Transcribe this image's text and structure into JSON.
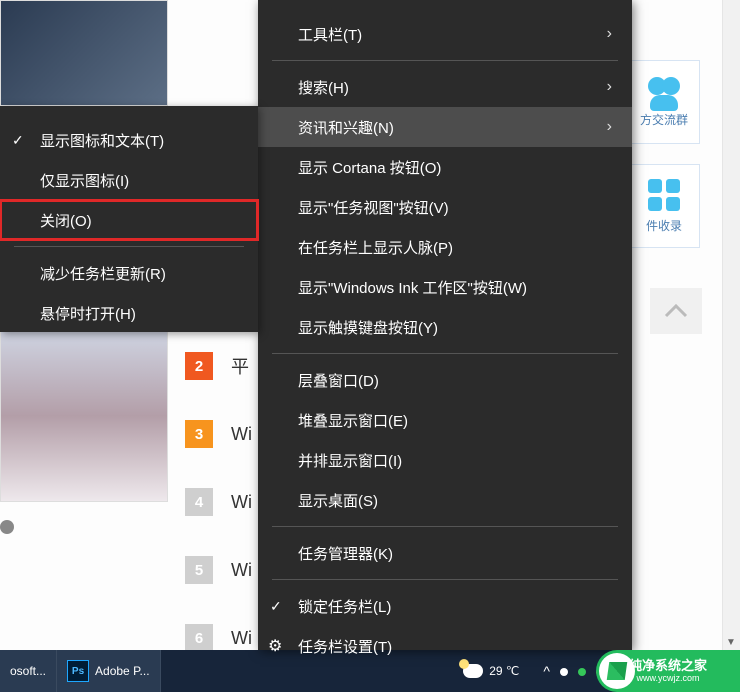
{
  "submenu": {
    "items": [
      {
        "label": "显示图标和文本(T)",
        "checked": true
      },
      {
        "label": "仅显示图标(I)",
        "checked": false
      },
      {
        "label": "关闭(O)",
        "checked": false,
        "highlighted": true
      }
    ],
    "group2": [
      {
        "label": "减少任务栏更新(R)"
      },
      {
        "label": "悬停时打开(H)"
      }
    ]
  },
  "contextmenu": {
    "g1": [
      {
        "label": "工具栏(T)",
        "arrow": true
      }
    ],
    "g2": [
      {
        "label": "搜索(H)",
        "arrow": true
      },
      {
        "label": "资讯和兴趣(N)",
        "arrow": true,
        "hover": true
      },
      {
        "label": "显示 Cortana 按钮(O)"
      },
      {
        "label": "显示\"任务视图\"按钮(V)"
      },
      {
        "label": "在任务栏上显示人脉(P)"
      },
      {
        "label": "显示\"Windows Ink 工作区\"按钮(W)"
      },
      {
        "label": "显示触摸键盘按钮(Y)"
      }
    ],
    "g3": [
      {
        "label": "层叠窗口(D)"
      },
      {
        "label": "堆叠显示窗口(E)"
      },
      {
        "label": "并排显示窗口(I)"
      },
      {
        "label": "显示桌面(S)"
      }
    ],
    "g4": [
      {
        "label": "任务管理器(K)"
      }
    ],
    "g5": [
      {
        "label": "锁定任务栏(L)",
        "checked": true
      },
      {
        "label": "任务栏设置(T)",
        "gear": true
      }
    ]
  },
  "bg_list": {
    "items": [
      {
        "n": "2",
        "text": "平",
        "cls": "n2"
      },
      {
        "n": "3",
        "text": "Wi",
        "cls": "n3"
      },
      {
        "n": "4",
        "text": "Wi",
        "cls": "n4"
      },
      {
        "n": "5",
        "text": "Wi",
        "cls": "n5"
      },
      {
        "n": "6",
        "text": "Wi",
        "cls": "n6"
      }
    ]
  },
  "side_cards": {
    "card1": "方交流群",
    "card2": "件收录"
  },
  "taskbar": {
    "app_edge_suffix": "osoft...",
    "ps_label": "Adobe P...",
    "ps_badge": "Ps",
    "weather_temp": "29 ℃",
    "tray_up": "^"
  },
  "watermark": {
    "line1": "纯净系统之家",
    "line2": "www.ycwjz.com"
  }
}
